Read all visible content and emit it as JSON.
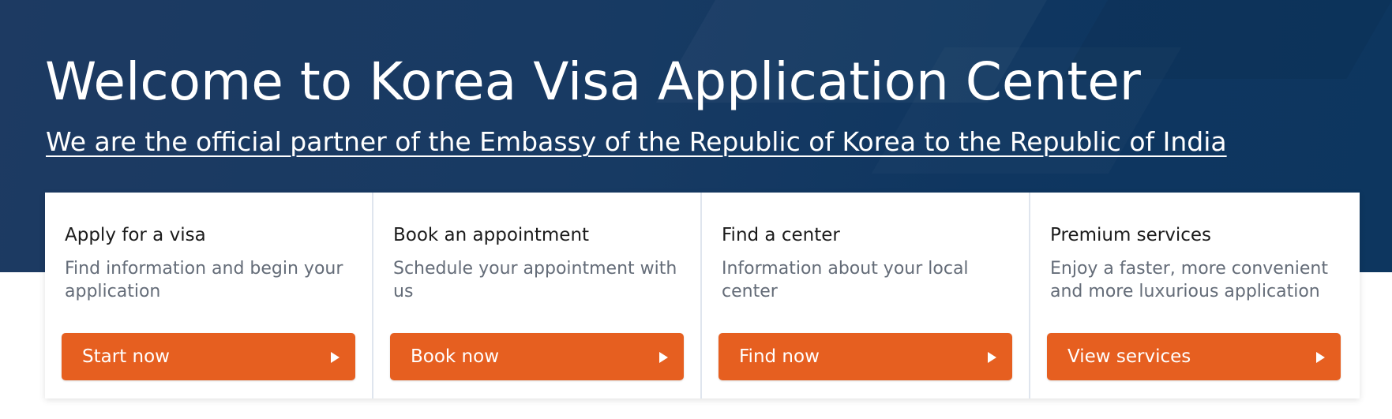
{
  "hero": {
    "title": "Welcome to Korea Visa Application Center",
    "subtitle": "We are the official partner of the Embassy of the Republic of Korea to the Republic of India",
    "background_color": "#173a63"
  },
  "cards": [
    {
      "title": "Apply for a visa",
      "description": "Find information and begin your application",
      "button_label": "Start now",
      "button_icon": "play-arrow-icon"
    },
    {
      "title": "Book an appointment",
      "description": "Schedule your appointment with us",
      "button_label": "Book now",
      "button_icon": "play-arrow-icon"
    },
    {
      "title": "Find a center",
      "description": "Information about your local center",
      "button_label": "Find now",
      "button_icon": "play-arrow-icon"
    },
    {
      "title": "Premium services",
      "description": "Enjoy a faster, more convenient and more luxurious application",
      "button_label": "View services",
      "button_icon": "play-arrow-icon"
    }
  ],
  "colors": {
    "accent": "#e65f20",
    "card_text": "#1b1b1b",
    "card_muted": "#646c78"
  }
}
